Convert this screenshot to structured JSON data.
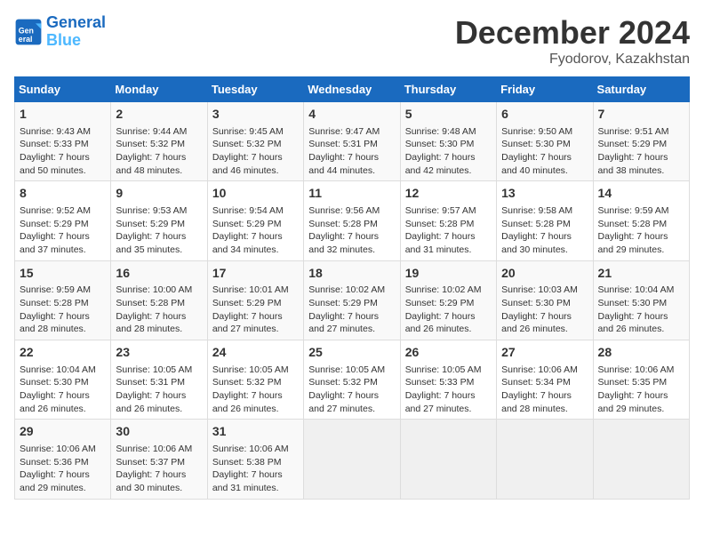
{
  "header": {
    "logo_line1": "General",
    "logo_line2": "Blue",
    "month_title": "December 2024",
    "location": "Fyodorov, Kazakhstan"
  },
  "weekdays": [
    "Sunday",
    "Monday",
    "Tuesday",
    "Wednesday",
    "Thursday",
    "Friday",
    "Saturday"
  ],
  "weeks": [
    [
      {
        "day": "1",
        "info": "Sunrise: 9:43 AM\nSunset: 5:33 PM\nDaylight: 7 hours\nand 50 minutes."
      },
      {
        "day": "2",
        "info": "Sunrise: 9:44 AM\nSunset: 5:32 PM\nDaylight: 7 hours\nand 48 minutes."
      },
      {
        "day": "3",
        "info": "Sunrise: 9:45 AM\nSunset: 5:32 PM\nDaylight: 7 hours\nand 46 minutes."
      },
      {
        "day": "4",
        "info": "Sunrise: 9:47 AM\nSunset: 5:31 PM\nDaylight: 7 hours\nand 44 minutes."
      },
      {
        "day": "5",
        "info": "Sunrise: 9:48 AM\nSunset: 5:30 PM\nDaylight: 7 hours\nand 42 minutes."
      },
      {
        "day": "6",
        "info": "Sunrise: 9:50 AM\nSunset: 5:30 PM\nDaylight: 7 hours\nand 40 minutes."
      },
      {
        "day": "7",
        "info": "Sunrise: 9:51 AM\nSunset: 5:29 PM\nDaylight: 7 hours\nand 38 minutes."
      }
    ],
    [
      {
        "day": "8",
        "info": "Sunrise: 9:52 AM\nSunset: 5:29 PM\nDaylight: 7 hours\nand 37 minutes."
      },
      {
        "day": "9",
        "info": "Sunrise: 9:53 AM\nSunset: 5:29 PM\nDaylight: 7 hours\nand 35 minutes."
      },
      {
        "day": "10",
        "info": "Sunrise: 9:54 AM\nSunset: 5:29 PM\nDaylight: 7 hours\nand 34 minutes."
      },
      {
        "day": "11",
        "info": "Sunrise: 9:56 AM\nSunset: 5:28 PM\nDaylight: 7 hours\nand 32 minutes."
      },
      {
        "day": "12",
        "info": "Sunrise: 9:57 AM\nSunset: 5:28 PM\nDaylight: 7 hours\nand 31 minutes."
      },
      {
        "day": "13",
        "info": "Sunrise: 9:58 AM\nSunset: 5:28 PM\nDaylight: 7 hours\nand 30 minutes."
      },
      {
        "day": "14",
        "info": "Sunrise: 9:59 AM\nSunset: 5:28 PM\nDaylight: 7 hours\nand 29 minutes."
      }
    ],
    [
      {
        "day": "15",
        "info": "Sunrise: 9:59 AM\nSunset: 5:28 PM\nDaylight: 7 hours\nand 28 minutes."
      },
      {
        "day": "16",
        "info": "Sunrise: 10:00 AM\nSunset: 5:28 PM\nDaylight: 7 hours\nand 28 minutes."
      },
      {
        "day": "17",
        "info": "Sunrise: 10:01 AM\nSunset: 5:29 PM\nDaylight: 7 hours\nand 27 minutes."
      },
      {
        "day": "18",
        "info": "Sunrise: 10:02 AM\nSunset: 5:29 PM\nDaylight: 7 hours\nand 27 minutes."
      },
      {
        "day": "19",
        "info": "Sunrise: 10:02 AM\nSunset: 5:29 PM\nDaylight: 7 hours\nand 26 minutes."
      },
      {
        "day": "20",
        "info": "Sunrise: 10:03 AM\nSunset: 5:30 PM\nDaylight: 7 hours\nand 26 minutes."
      },
      {
        "day": "21",
        "info": "Sunrise: 10:04 AM\nSunset: 5:30 PM\nDaylight: 7 hours\nand 26 minutes."
      }
    ],
    [
      {
        "day": "22",
        "info": "Sunrise: 10:04 AM\nSunset: 5:30 PM\nDaylight: 7 hours\nand 26 minutes."
      },
      {
        "day": "23",
        "info": "Sunrise: 10:05 AM\nSunset: 5:31 PM\nDaylight: 7 hours\nand 26 minutes."
      },
      {
        "day": "24",
        "info": "Sunrise: 10:05 AM\nSunset: 5:32 PM\nDaylight: 7 hours\nand 26 minutes."
      },
      {
        "day": "25",
        "info": "Sunrise: 10:05 AM\nSunset: 5:32 PM\nDaylight: 7 hours\nand 27 minutes."
      },
      {
        "day": "26",
        "info": "Sunrise: 10:05 AM\nSunset: 5:33 PM\nDaylight: 7 hours\nand 27 minutes."
      },
      {
        "day": "27",
        "info": "Sunrise: 10:06 AM\nSunset: 5:34 PM\nDaylight: 7 hours\nand 28 minutes."
      },
      {
        "day": "28",
        "info": "Sunrise: 10:06 AM\nSunset: 5:35 PM\nDaylight: 7 hours\nand 29 minutes."
      }
    ],
    [
      {
        "day": "29",
        "info": "Sunrise: 10:06 AM\nSunset: 5:36 PM\nDaylight: 7 hours\nand 29 minutes."
      },
      {
        "day": "30",
        "info": "Sunrise: 10:06 AM\nSunset: 5:37 PM\nDaylight: 7 hours\nand 30 minutes."
      },
      {
        "day": "31",
        "info": "Sunrise: 10:06 AM\nSunset: 5:38 PM\nDaylight: 7 hours\nand 31 minutes."
      },
      {
        "day": "",
        "info": ""
      },
      {
        "day": "",
        "info": ""
      },
      {
        "day": "",
        "info": ""
      },
      {
        "day": "",
        "info": ""
      }
    ]
  ]
}
